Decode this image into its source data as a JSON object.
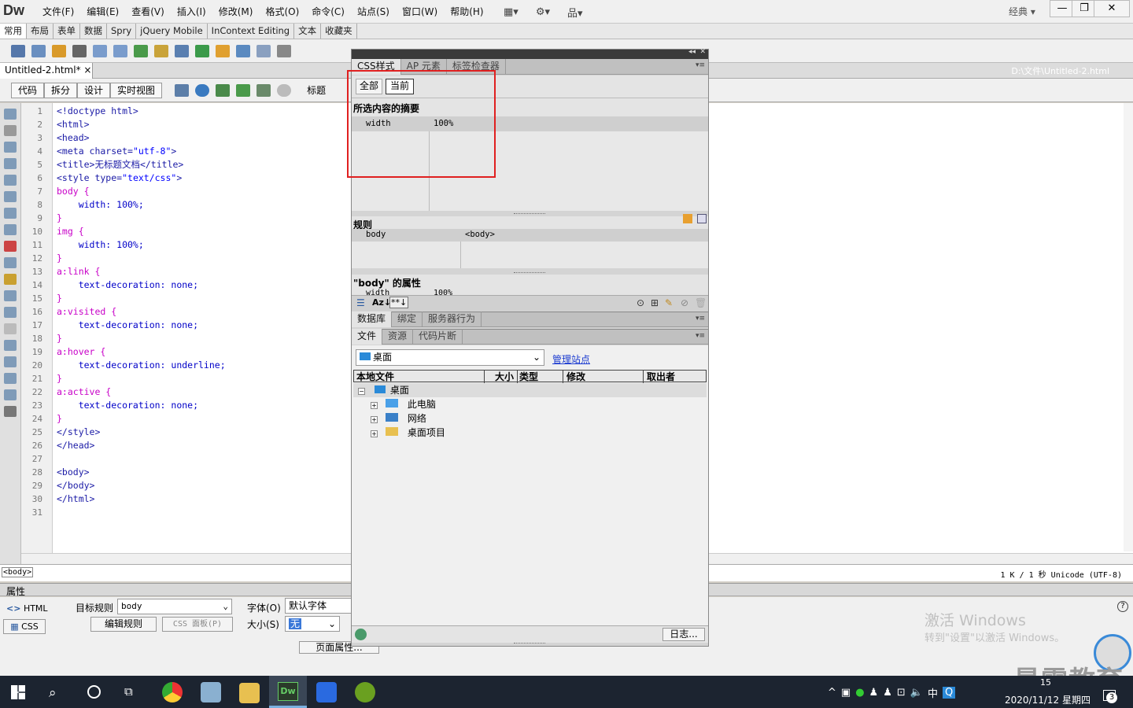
{
  "app": {
    "logo": "Dw",
    "workspace": "经典",
    "win_min": "—",
    "win_max": "❐",
    "win_close": "✕"
  },
  "menu": [
    "文件(F)",
    "编辑(E)",
    "查看(V)",
    "插入(I)",
    "修改(M)",
    "格式(O)",
    "命令(C)",
    "站点(S)",
    "窗口(W)",
    "帮助(H)"
  ],
  "insert_tabs": [
    "常用",
    "布局",
    "表单",
    "数据",
    "Spry",
    "jQuery Mobile",
    "InContext Editing",
    "文本",
    "收藏夹"
  ],
  "document": {
    "tab": "Untitled-2.html*",
    "path": "D:\\文件\\Untitled-2.html"
  },
  "view_buttons": [
    "代码",
    "拆分",
    "设计",
    "实时视图"
  ],
  "title_label": "标题",
  "code_lines": [
    "<!doctype html>",
    "<html>",
    "<head>",
    "<meta charset=\"utf-8\">",
    "<title>无标题文档</title>",
    "<style type=\"text/css\">",
    "body {",
    "    width: 100%;",
    "}",
    "img {",
    "    width: 100%;",
    "}",
    "a:link {",
    "    text-decoration: none;",
    "}",
    "a:visited {",
    "    text-decoration: none;",
    "}",
    "a:hover {",
    "    text-decoration: underline;",
    "}",
    "a:active {",
    "    text-decoration: none;",
    "}",
    "</style>",
    "</head>",
    "",
    "<body>",
    "</body>",
    "</html>",
    ""
  ],
  "status": {
    "tag": "<body>",
    "info": "1 K / 1 秒 Unicode (UTF-8)"
  },
  "css_panel": {
    "tabs": [
      "CSS样式",
      "AP 元素",
      "标签检查器"
    ],
    "mode_all": "全部",
    "mode_current": "当前",
    "summary_title": "所选内容的摘要",
    "summary_prop": "width",
    "summary_val": "100%",
    "rules_title": "规则",
    "rule_name": "body",
    "rule_tag": "<body>",
    "props_title": "\"body\" 的属性",
    "props_prop": "width",
    "props_val": "100%",
    "az_label": "Az↓",
    "star_label": "**↓"
  },
  "db_panel": {
    "tabs": [
      "数据库",
      "绑定",
      "服务器行为"
    ]
  },
  "files_panel": {
    "tabs": [
      "文件",
      "资源",
      "代码片断"
    ],
    "site": "桌面",
    "manage": "管理站点",
    "headers": [
      "本地文件",
      "大小",
      "类型",
      "修改",
      "取出者"
    ],
    "root": "桌面",
    "items": [
      "此电脑",
      "网络",
      "桌面项目"
    ],
    "log_button": "日志..."
  },
  "properties": {
    "title": "属性",
    "html_btn": "HTML",
    "css_btn": "CSS",
    "target_rule_label": "目标规则",
    "target_rule": "body",
    "edit_rule": "编辑规则",
    "css_panel_btn": "CSS 面板(P)",
    "font_label": "字体(O)",
    "font_value": "默认字体",
    "size_label": "大小(S)",
    "size_value": "无",
    "page_props": "页面属性..."
  },
  "watermark": {
    "line1": "激活 Windows",
    "line2": "转到\"设置\"以激活 Windows。",
    "brand": "最需教育"
  },
  "taskbar": {
    "ime": "中",
    "datetime": "2020/11/12 星期四",
    "notif_count": "3",
    "time_partial": "15"
  }
}
